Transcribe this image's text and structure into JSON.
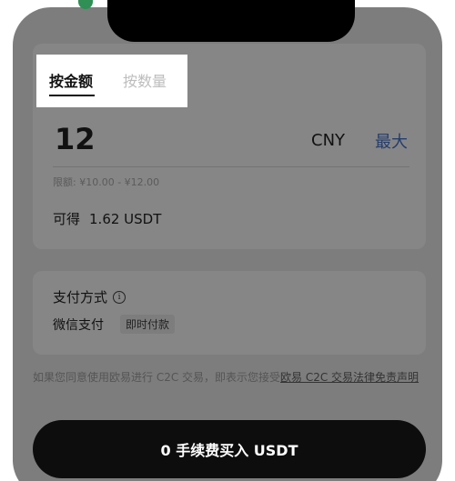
{
  "tabs": {
    "by_amount": "按金额",
    "by_quantity": "按数量"
  },
  "amount": {
    "value": "12",
    "currency": "CNY",
    "max_label": "最大"
  },
  "limit_text": "限额: ¥10.00 - ¥12.00",
  "receive": {
    "label": "可得",
    "value": "1.62 USDT"
  },
  "payment": {
    "title": "支付方式",
    "info_icon": "ⓘ",
    "method": "微信支付",
    "tag": "即时付款"
  },
  "agreement": {
    "text": "如果您同意使用欧易进行 C2C 交易，即表示您接受",
    "link": "欧易 C2C 交易法律免责声明"
  },
  "buy_button_label": "0 手续费买入 USDT",
  "colors": {
    "link": "#243c6c",
    "button_bg": "#0d0d0d",
    "overlay": "#7d7d7d"
  }
}
